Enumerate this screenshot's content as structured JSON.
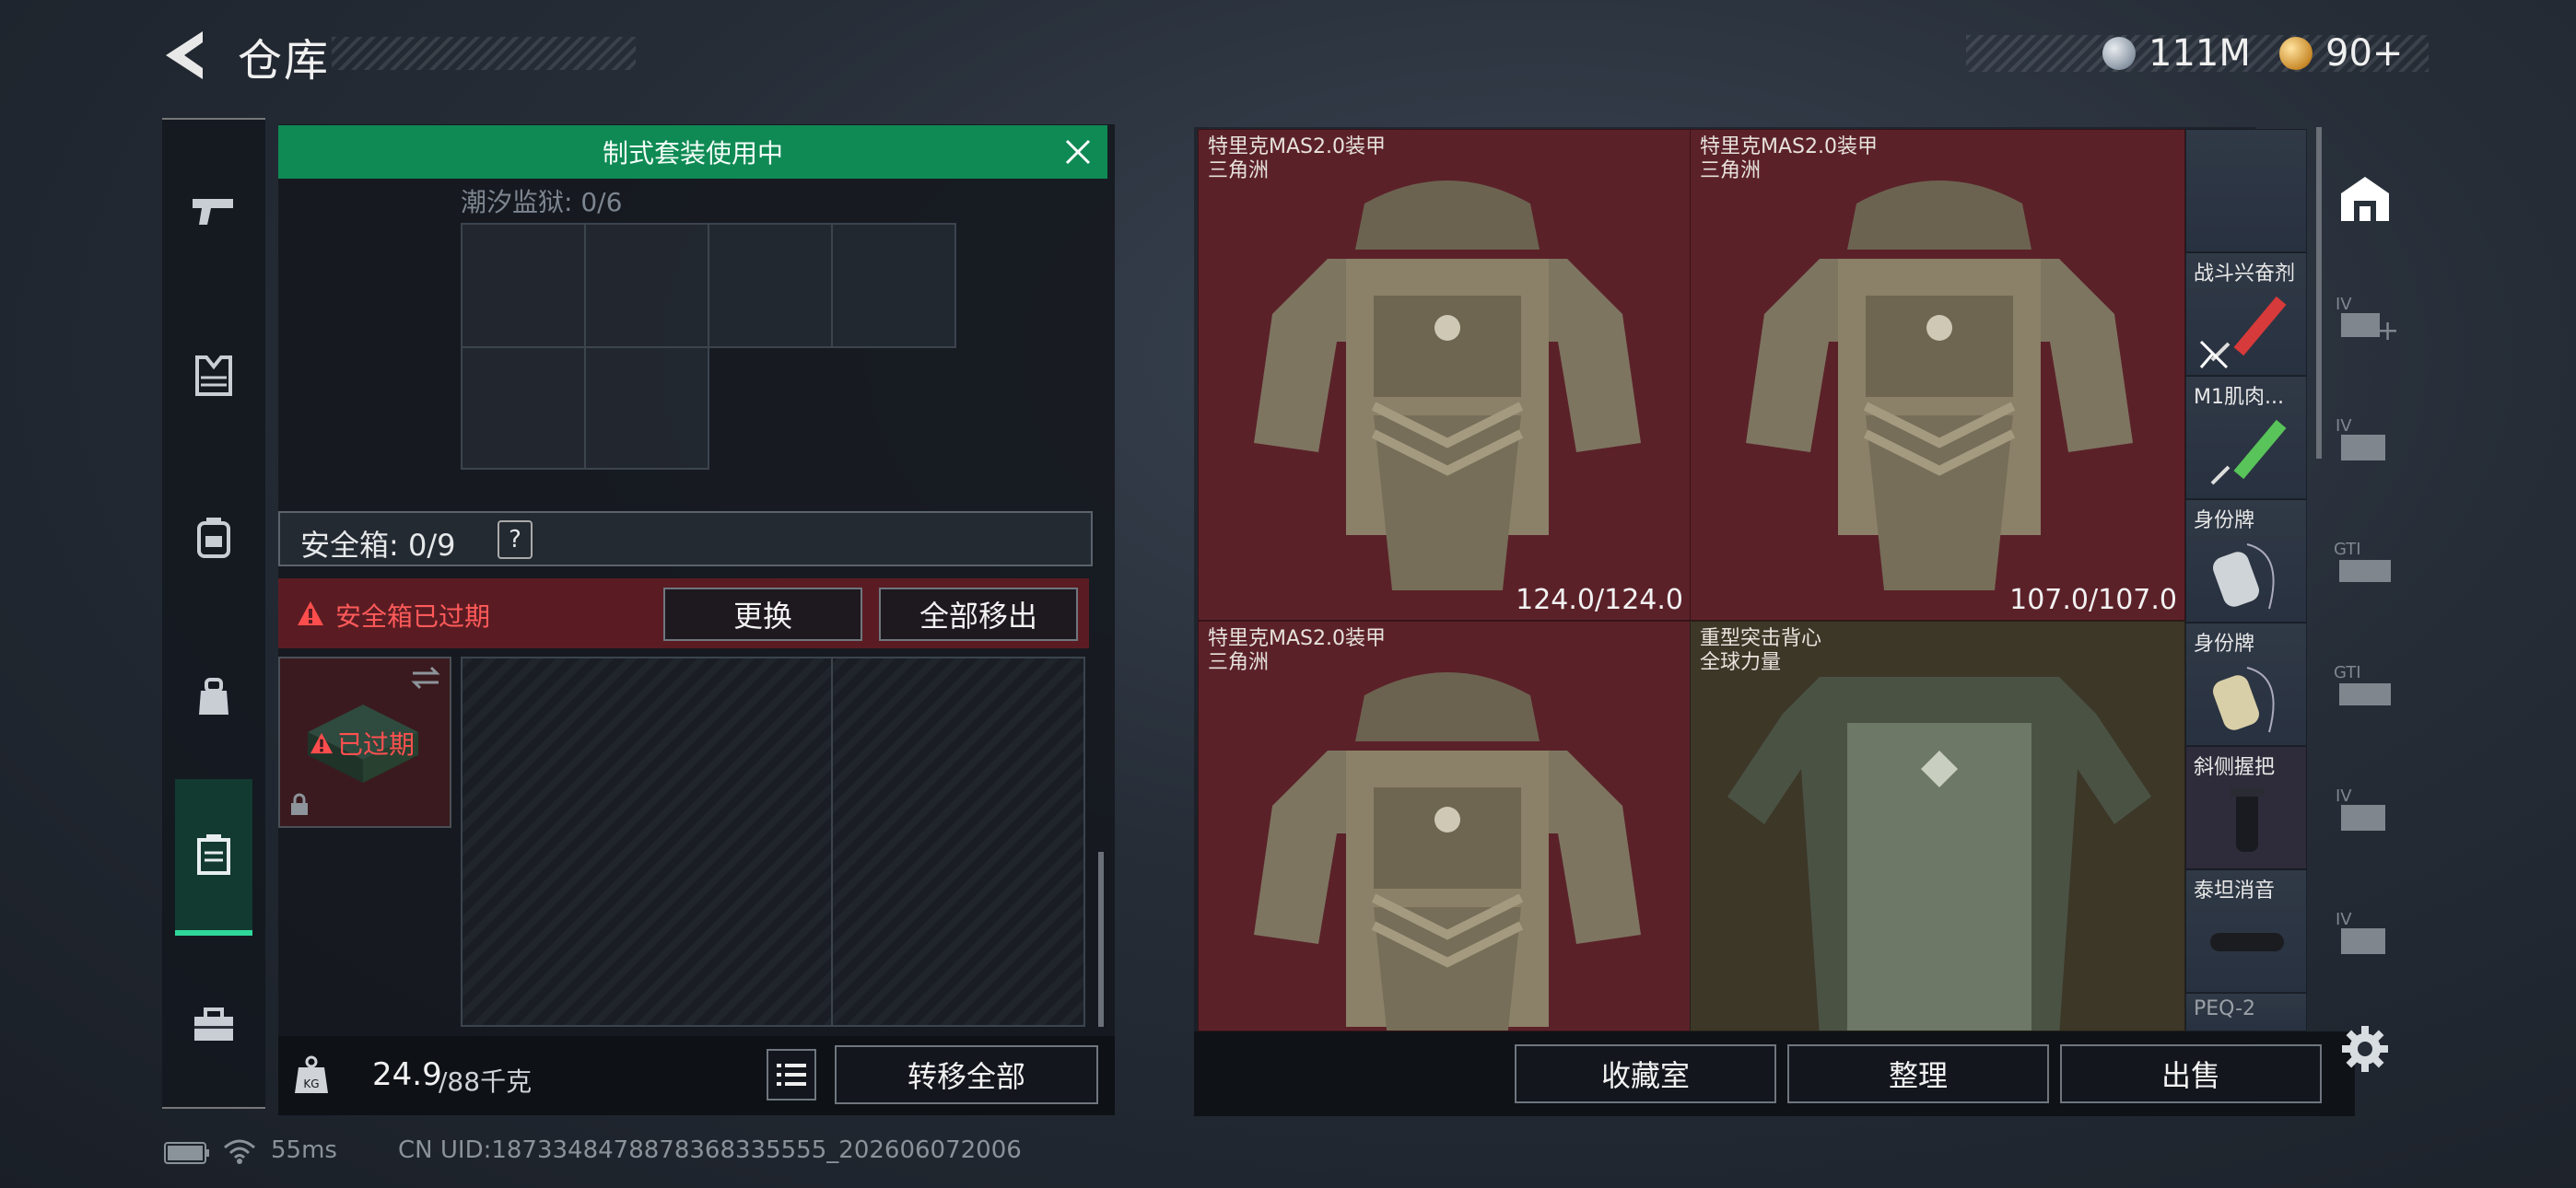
{
  "header": {
    "title": "仓库",
    "currency": [
      {
        "icon": "silver-coin-icon",
        "value": "111M"
      },
      {
        "icon": "gold-coin-icon",
        "value": "90+"
      }
    ]
  },
  "left_tabs": [
    {
      "icon": "pistol-icon"
    },
    {
      "icon": "vest-icon"
    },
    {
      "icon": "backpack-icon"
    },
    {
      "icon": "pouch-icon"
    },
    {
      "icon": "safe-box-icon",
      "active": true
    },
    {
      "icon": "toolbox-icon"
    }
  ],
  "loadout": {
    "banner": "制式套装使用中",
    "container_label": "潮汐监狱: 0/6",
    "safe_box_label": "安全箱: 0/9",
    "help": "?",
    "expired_warning": "安全箱已过期",
    "replace_button": "更换",
    "remove_all_button": "全部移出",
    "expired_badge": "已过期",
    "weight_value": "24.9",
    "weight_max": "/88千克",
    "transfer_all_button": "转移全部"
  },
  "storage": {
    "large_items": [
      {
        "name": "特里克MAS2.0装甲",
        "sub": "三角洲",
        "durability": "124.0/124.0"
      },
      {
        "name": "特里克MAS2.0装甲",
        "sub": "三角洲",
        "durability": "107.0/107.0"
      },
      {
        "name": "特里克MAS2.0装甲",
        "sub": "三角洲",
        "durability": ""
      },
      {
        "name": "重型突击背心",
        "sub": "全球力量",
        "durability": ""
      }
    ],
    "small_items": [
      {
        "name": "战斗兴奋剂"
      },
      {
        "name": "M1肌肉..."
      },
      {
        "name": "身份牌"
      },
      {
        "name": "身份牌"
      },
      {
        "name": "斜侧握把"
      },
      {
        "name": "泰坦消音"
      },
      {
        "name": "PEQ-2"
      }
    ],
    "buttons": {
      "collection": "收藏室",
      "sort": "整理",
      "sell": "出售"
    }
  },
  "right_sidebar": [
    {
      "icon": "warehouse-icon"
    },
    {
      "icon": "storage-iv-add-icon",
      "label": "IV"
    },
    {
      "icon": "storage-iv-icon",
      "label": "IV"
    },
    {
      "icon": "storage-gti-icon",
      "label": "GTI"
    },
    {
      "icon": "storage-gti-2-icon",
      "label": "GTI"
    },
    {
      "icon": "storage-iv-2-icon",
      "label": "IV"
    },
    {
      "icon": "storage-iv-3-icon",
      "label": "IV"
    }
  ],
  "status_bar": {
    "ping": "55ms",
    "uid": "CN UID:1873348478878368335555_202606072006"
  },
  "colors": {
    "accent_green": "#0f8a55",
    "expired_red": "#e23b3b",
    "item_red": "#5b2129"
  }
}
